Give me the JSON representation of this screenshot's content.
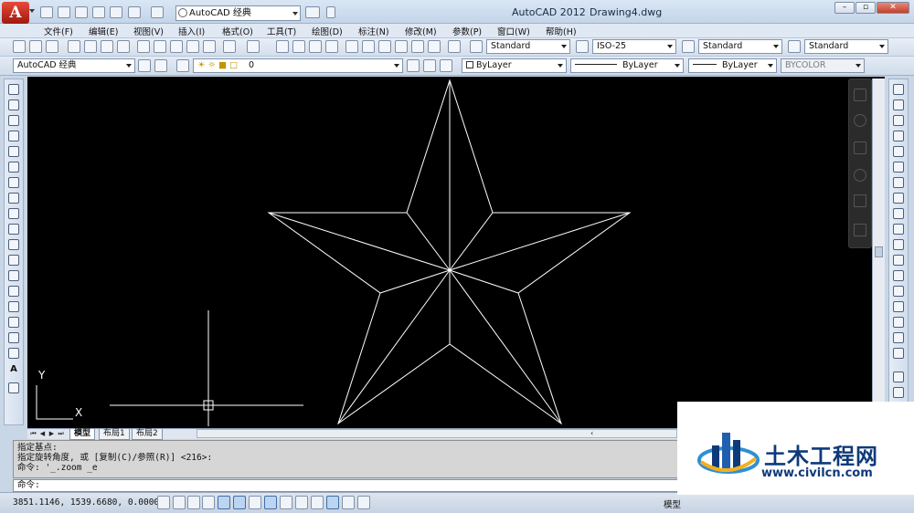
{
  "titlebar": {
    "logo_letter": "A",
    "workspace": "AutoCAD 经典",
    "app_title": "AutoCAD 2012",
    "doc_title": "Drawing4.dwg"
  },
  "menu": [
    "文件(F)",
    "编辑(E)",
    "视图(V)",
    "插入(I)",
    "格式(O)",
    "工具(T)",
    "绘图(D)",
    "标注(N)",
    "修改(M)",
    "参数(P)",
    "窗口(W)",
    "帮助(H)"
  ],
  "toolbar1": {
    "text_style": "Standard",
    "dim_style": "ISO-25",
    "table_style": "Standard",
    "multileader_style": "Standard"
  },
  "toolbar2": {
    "workspace": "AutoCAD 经典",
    "layer": "0",
    "color": "ByLayer",
    "linetype": "ByLayer",
    "lineweight": "ByLayer",
    "plot_style": "BYCOLOR"
  },
  "ucs": {
    "x_label": "X",
    "y_label": "Y"
  },
  "tabs": [
    "模型",
    "布局1",
    "布局2"
  ],
  "command": {
    "history": [
      "指定基点:",
      "指定旋转角度, 或 [复制(C)/参照(R)] <216>:",
      "命令: '_.zoom _e"
    ],
    "prompt": "命令:"
  },
  "status": {
    "coordinates": "3851.1146, 1539.6680, 0.0000",
    "model": "模型"
  },
  "watermark": {
    "brand": "土木工程网",
    "url": "www.civilcn.com"
  },
  "colors": {
    "canvas_bg": "#000000",
    "geometry": "#ffffff",
    "brand_blue": "#0e3a7a"
  }
}
